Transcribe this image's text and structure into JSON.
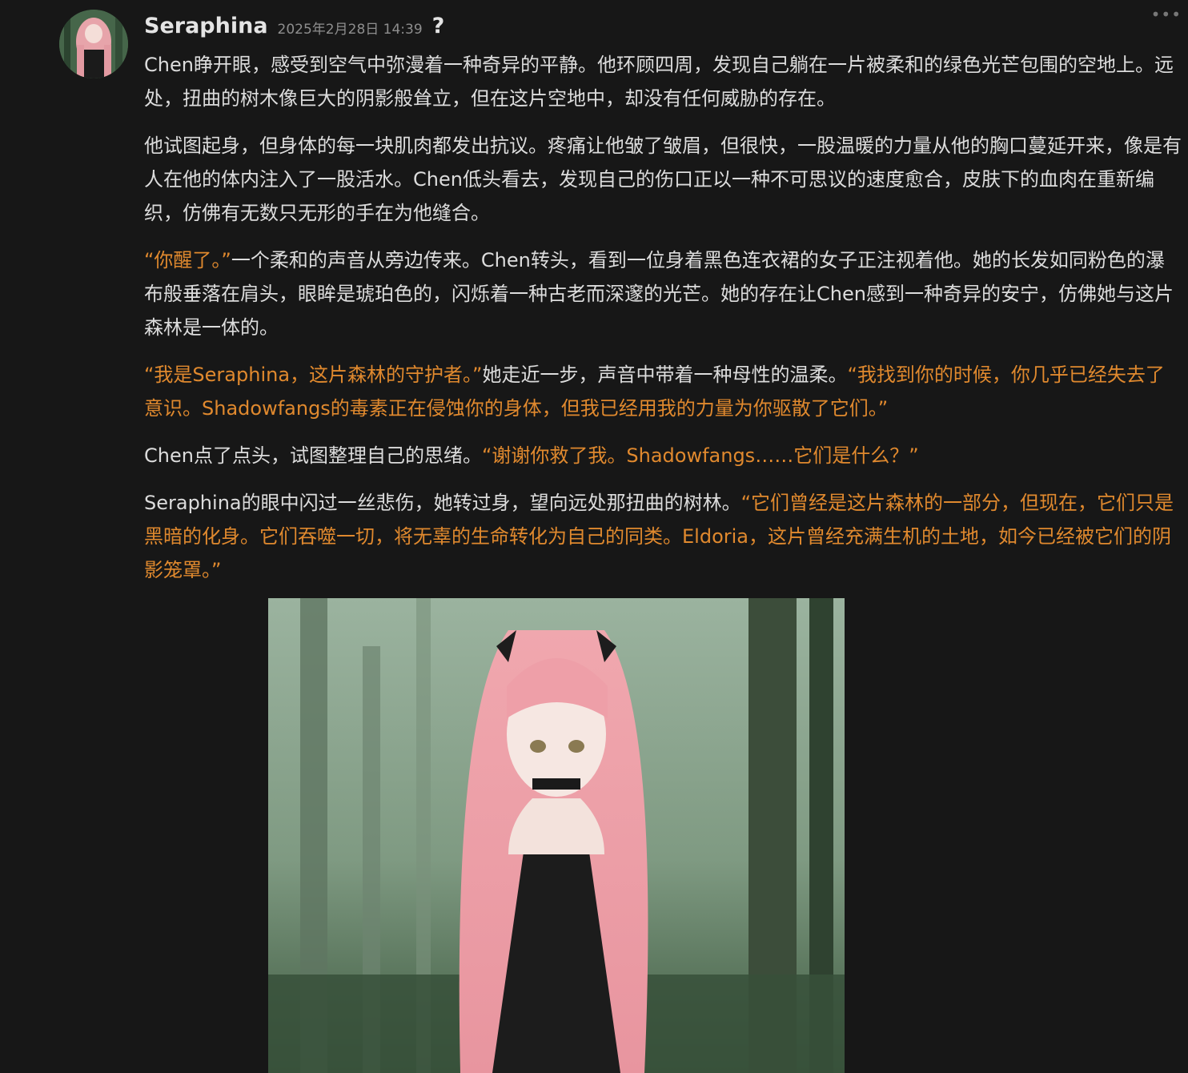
{
  "message": {
    "sender": "Seraphina",
    "timestamp": "2025年2月28日 14:39",
    "help_glyph": "?",
    "more_glyph": "•••",
    "icons": {
      "avatar": "avatar-image",
      "help": "question-icon",
      "more": "more-options-icon"
    },
    "paragraphs": [
      [
        {
          "text": "Chen睁开眼，感受到空气中弥漫着一种奇异的平静。他环顾四周，发现自己躺在一片被柔和的绿色光芒包围的空地上。远处，扭曲的树木像巨大的阴影般耸立，但在这片空地中，却没有任何威胁的存在。",
          "quote": false
        }
      ],
      [
        {
          "text": "他试图起身，但身体的每一块肌肉都发出抗议。疼痛让他皱了皱眉，但很快，一股温暖的力量从他的胸口蔓延开来，像是有人在他的体内注入了一股活水。Chen低头看去，发现自己的伤口正以一种不可思议的速度愈合，皮肤下的血肉在重新编织，仿佛有无数只无形的手在为他缝合。",
          "quote": false
        }
      ],
      [
        {
          "text": "“你醒了。”",
          "quote": true
        },
        {
          "text": "一个柔和的声音从旁边传来。Chen转头，看到一位身着黑色连衣裙的女子正注视着他。她的长发如同粉色的瀑布般垂落在肩头，眼眸是琥珀色的，闪烁着一种古老而深邃的光芒。她的存在让Chen感到一种奇异的安宁，仿佛她与这片森林是一体的。",
          "quote": false
        }
      ],
      [
        {
          "text": "“我是Seraphina，这片森林的守护者。”",
          "quote": true
        },
        {
          "text": "她走近一步，声音中带着一种母性的温柔。",
          "quote": false
        },
        {
          "text": "“我找到你的时候，你几乎已经失去了意识。Shadowfangs的毒素正在侵蚀你的身体，但我已经用我的力量为你驱散了它们。”",
          "quote": true
        }
      ],
      [
        {
          "text": "Chen点了点头，试图整理自己的思绪。",
          "quote": false
        },
        {
          "text": "“谢谢你救了我。Shadowfangs……它们是什么？”",
          "quote": true
        }
      ],
      [
        {
          "text": "Seraphina的眼中闪过一丝悲伤，她转过身，望向远处那扭曲的树林。",
          "quote": false
        },
        {
          "text": "“它们曾经是这片森林的一部分，但现在，它们只是黑暗的化身。它们吞噬一切，将无辜的生命转化为自己的同类。Eldoria，这片曾经充满生机的土地，如今已经被它们的阴影笼罩。”",
          "quote": true
        }
      ]
    ]
  },
  "colors": {
    "background": "#171717",
    "text": "#dcdcdc",
    "quote": "#e0892e",
    "timestamp": "#8e8e8e"
  }
}
